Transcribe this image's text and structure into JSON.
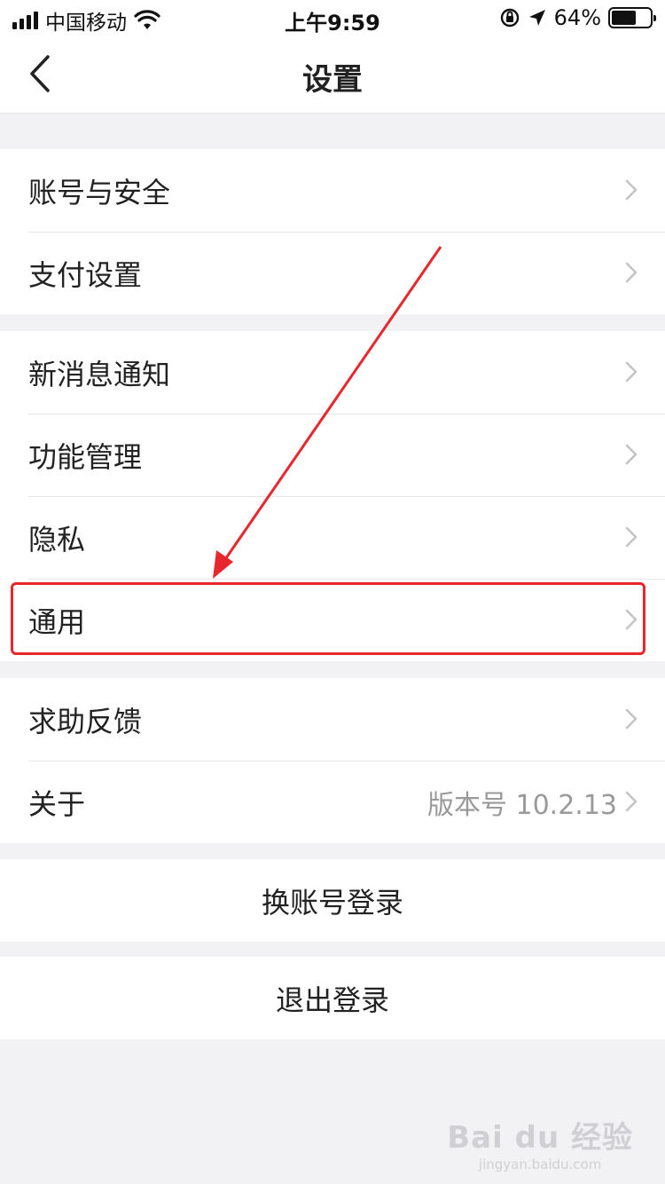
{
  "status_bar": {
    "carrier": "中国移动",
    "time": "上午9:59",
    "battery_percent": "64%",
    "battery_level": 0.64
  },
  "nav": {
    "title": "设置"
  },
  "groups": [
    {
      "items": [
        {
          "label": "账号与安全"
        },
        {
          "label": "支付设置"
        }
      ]
    },
    {
      "items": [
        {
          "label": "新消息通知"
        },
        {
          "label": "功能管理"
        },
        {
          "label": "隐私"
        },
        {
          "label": "通用"
        }
      ]
    },
    {
      "items": [
        {
          "label": "求助反馈"
        },
        {
          "label": "关于",
          "value": "版本号 10.2.13"
        }
      ]
    }
  ],
  "actions": {
    "switch_account": "换账号登录",
    "logout": "退出登录"
  },
  "annotation": {
    "color": "#e8262d",
    "highlighted_item": "通用"
  },
  "watermark": {
    "logo": "Bai du 经验",
    "url": "jingyan.baidu.com"
  },
  "icons": [
    "signal-icon",
    "wifi-icon",
    "orientation-lock-icon",
    "location-arrow-icon",
    "battery-icon",
    "back-chevron-icon",
    "chevron-right-icon"
  ]
}
